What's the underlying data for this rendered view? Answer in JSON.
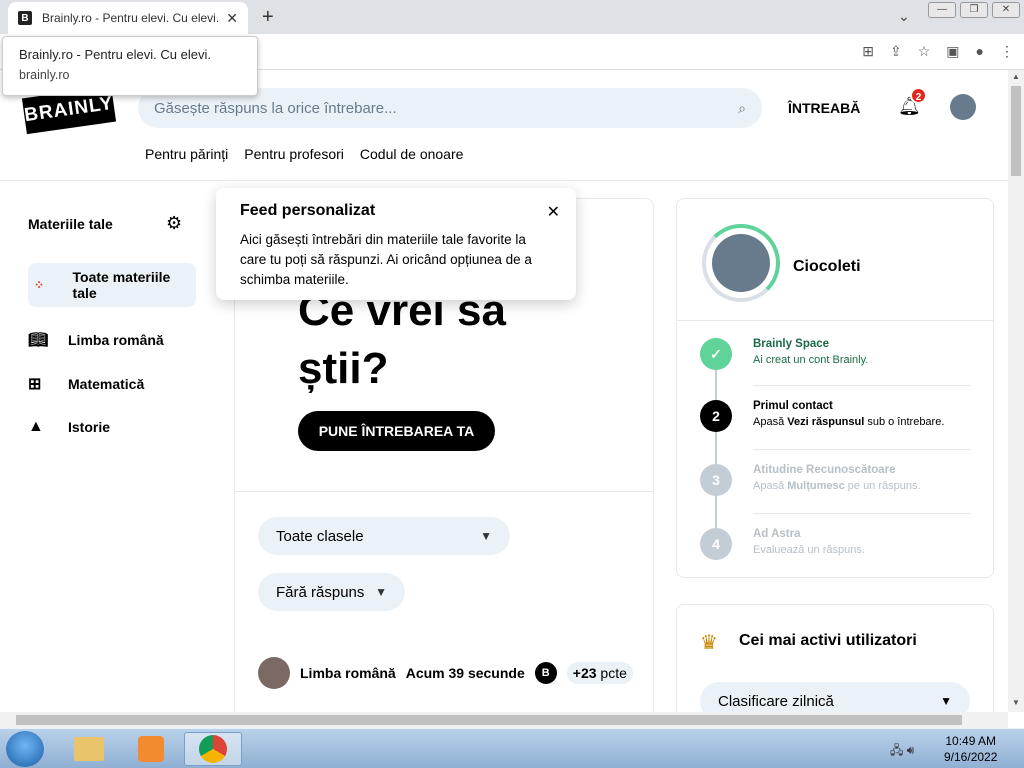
{
  "browser": {
    "tab_title": "Brainly.ro - Pentru elevi. Cu elevi.",
    "tab_favicon": "B",
    "tooltip_title": "Brainly.ro - Pentru elevi. Cu elevi.",
    "tooltip_url": "brainly.ro"
  },
  "header": {
    "logo_text": "BRAINLY",
    "search_placeholder": "Găsește răspuns la orice întrebare...",
    "ask_label": "ÎNTREABĂ",
    "notif_count": "2",
    "nav_links": [
      "Pentru părinți",
      "Pentru profesori",
      "Codul de onoare"
    ]
  },
  "sidebar": {
    "title": "Materiile tale",
    "subjects": [
      {
        "label": "Toate materiile tale",
        "icon": "grid-dots-icon"
      },
      {
        "label": "Limba română",
        "icon": "book-icon"
      },
      {
        "label": "Matematică",
        "icon": "math-icon"
      },
      {
        "label": "Istorie",
        "icon": "pyramid-icon"
      }
    ]
  },
  "popover": {
    "title": "Feed personalizat",
    "body": "Aici găsești întrebări din materiile tale favorite la care tu poți să răspunzi. Ai oricând opțiunea de a schimba materiile."
  },
  "main": {
    "hero_line1": "Ce vrei să",
    "hero_line2": "știi?",
    "ask_button": "PUNE ÎNTREBAREA TA",
    "filter_class": "Toate clasele",
    "filter_answer": "Fără răspuns",
    "question_meta": {
      "subject": "Limba română",
      "time": "Acum 39 secunde",
      "points": "+23",
      "points_unit": "pcte"
    }
  },
  "profile": {
    "name": "Ciocoleti",
    "steps": [
      {
        "num": "✓",
        "title": "Brainly Space",
        "desc": "Ai creat un cont Brainly.",
        "state": "done"
      },
      {
        "num": "2",
        "title": "Primul contact",
        "desc_pre": "Apasă ",
        "desc_bold": "Vezi răspunsul",
        "desc_post": " sub o întrebare.",
        "state": "current"
      },
      {
        "num": "3",
        "title": "Atitudine Recunoscătoare",
        "desc_pre": "Apasă ",
        "desc_bold": "Mulțumesc",
        "desc_post": " pe un răspuns.",
        "state": "todo"
      },
      {
        "num": "4",
        "title": "Ad Astra",
        "desc": "Evaluează un răspuns.",
        "state": "todo"
      }
    ]
  },
  "active_users": {
    "title": "Cei mai activi utilizatori",
    "ranking": "Clasificare zilnică"
  },
  "taskbar": {
    "time": "10:49 AM",
    "date": "9/16/2022"
  },
  "colors": {
    "accent_green": "#60d399",
    "badge_red": "#e0291a",
    "search_bg": "#ebf2f7"
  }
}
